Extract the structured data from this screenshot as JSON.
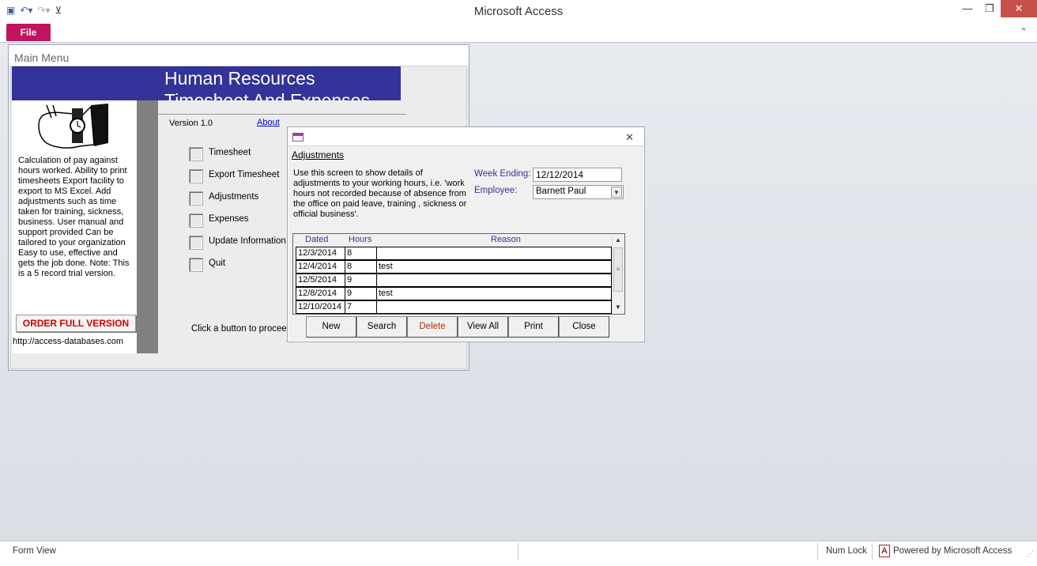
{
  "window": {
    "title": "Microsoft Access",
    "minimize_glyph": "—",
    "restore_glyph": "❐",
    "close_glyph": "✕"
  },
  "ribbon": {
    "file_tab": "File",
    "collapse_glyph": "⌃"
  },
  "main_menu": {
    "title": "Main Menu",
    "banner_line1": "Human Resources",
    "banner_line2": "Timesheet And Expenses",
    "version": "Version 1.0",
    "about_link": "About",
    "description": "Calculation of pay against hours worked. Ability to print timesheets Export facility to export to MS Excel. Add adjustments such as time taken for training, sickness, business. User manual and support provided Can be tailored to your organization Easy to use, effective and gets the job done. Note: This is a 5 record trial version.",
    "order_button": "ORDER FULL VERSION",
    "url": "http://access-databases.com",
    "nav_items": [
      "Timesheet",
      "Export Timesheet",
      "Adjustments",
      "Expenses",
      "Update Information",
      "Quit"
    ],
    "proceed_text": "Click a button to proceed."
  },
  "adjustments": {
    "title": "Adjustments",
    "close_glyph": "✕",
    "description": "Use this screen to show details of adjustments to your working hours, i.e. 'work hours not recorded because of absence from the office on paid leave, training , sickness or official business'.",
    "week_ending_label": "Week Ending:",
    "week_ending_value": "12/12/2014",
    "employee_label": "Employee:",
    "employee_value": "Barnett Paul",
    "grid": {
      "headers": [
        "Dated",
        "Hours",
        "Reason"
      ],
      "rows": [
        {
          "dated": "12/3/2014",
          "hours": "8",
          "reason": ""
        },
        {
          "dated": "12/4/2014",
          "hours": "8",
          "reason": "test"
        },
        {
          "dated": "12/5/2014",
          "hours": "9",
          "reason": ""
        },
        {
          "dated": "12/8/2014",
          "hours": "9",
          "reason": "test"
        },
        {
          "dated": "12/10/2014",
          "hours": "7",
          "reason": ""
        }
      ]
    },
    "buttons": {
      "new": "New",
      "search": "Search",
      "delete": "Delete",
      "view_all": "View All",
      "print": "Print",
      "close": "Close"
    }
  },
  "statusbar": {
    "view": "Form View",
    "num_lock": "Num Lock",
    "app_badge": "A",
    "powered": "Powered by Microsoft Access"
  }
}
